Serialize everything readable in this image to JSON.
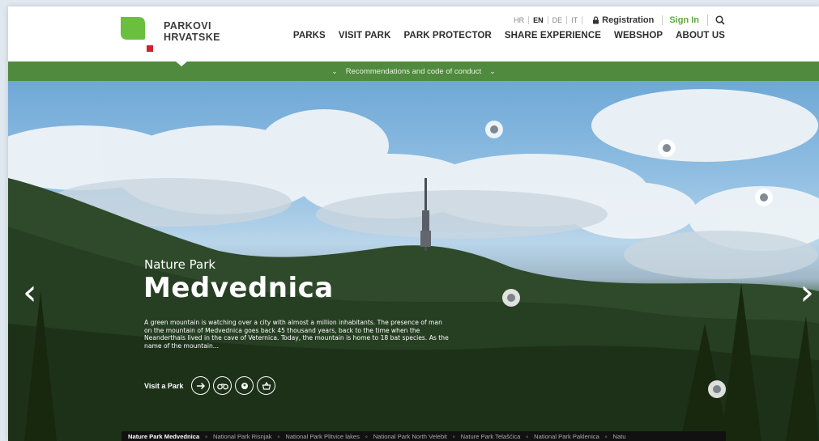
{
  "logo": {
    "line1": "PARKOVI",
    "line2": "HRVATSKE"
  },
  "languages": [
    {
      "code": "HR",
      "active": false
    },
    {
      "code": "EN",
      "active": true
    },
    {
      "code": "DE",
      "active": false
    },
    {
      "code": "IT",
      "active": false
    }
  ],
  "account": {
    "registration": "Registration",
    "sign_in": "Sign In"
  },
  "nav": [
    "PARKS",
    "VISIT PARK",
    "PARK PROTECTOR",
    "SHARE EXPERIENCE",
    "WEBSHOP",
    "ABOUT US"
  ],
  "greenbar": {
    "label": "Recommendations and code of conduct"
  },
  "hero": {
    "subtitle": "Nature Park",
    "title": "Medvednica",
    "description": "A green mountain is watching over a city with almost a million inhabitants. The presence of man on the mountain of Medvednica goes back 45 thousand years, back to the time when the Neanderthals lived in the cave of Veternica. Today, the mountain is home to 18 bat species. As the name of the mountain...",
    "visit_label": "Visit a Park",
    "action_icons": [
      "arrow-right-icon",
      "binoculars-icon",
      "bird-icon",
      "basket-icon"
    ]
  },
  "bottom_nav": [
    "Nature Park Medvednica",
    "National Park Risnjak",
    "National Park Plitvice lakes",
    "National Park North Velebit",
    "Nature Park Telašćica",
    "National Park Paklenica",
    "Natu"
  ],
  "colors": {
    "brand_green": "#4f8a3e",
    "accent_green": "#5cab3a",
    "logo_red": "#d0202f"
  }
}
